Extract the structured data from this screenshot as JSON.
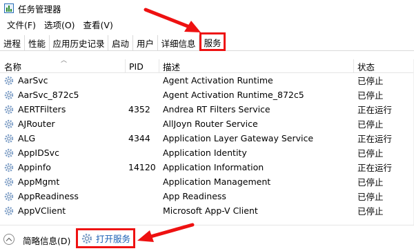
{
  "window": {
    "title": "任务管理器",
    "icon": "task-manager-icon"
  },
  "menu": [
    "文件(F)",
    "选项(O)",
    "查看(V)"
  ],
  "tabs": [
    "进程",
    "性能",
    "应用历史记录",
    "启动",
    "用户",
    "详细信息",
    "服务"
  ],
  "active_tab": "服务",
  "columns": {
    "name": "名称",
    "pid": "PID",
    "desc": "描述",
    "status": "状态"
  },
  "services": [
    {
      "name": "AarSvc",
      "pid": "",
      "desc": "Agent Activation Runtime",
      "status": "已停止"
    },
    {
      "name": "AarSvc_872c5",
      "pid": "",
      "desc": "Agent Activation Runtime_872c5",
      "status": "已停止"
    },
    {
      "name": "AERTFilters",
      "pid": "4352",
      "desc": "Andrea RT Filters Service",
      "status": "正在运行"
    },
    {
      "name": "AJRouter",
      "pid": "",
      "desc": "AllJoyn Router Service",
      "status": "已停止"
    },
    {
      "name": "ALG",
      "pid": "4344",
      "desc": "Application Layer Gateway Service",
      "status": "正在运行"
    },
    {
      "name": "AppIDSvc",
      "pid": "",
      "desc": "Application Identity",
      "status": "已停止"
    },
    {
      "name": "Appinfo",
      "pid": "14120",
      "desc": "Application Information",
      "status": "正在运行"
    },
    {
      "name": "AppMgmt",
      "pid": "",
      "desc": "Application Management",
      "status": "已停止"
    },
    {
      "name": "AppReadiness",
      "pid": "",
      "desc": "App Readiness",
      "status": "已停止"
    },
    {
      "name": "AppVClient",
      "pid": "",
      "desc": "Microsoft App-V Client",
      "status": "已停止"
    }
  ],
  "footer": {
    "brief_label": "简略信息(D)",
    "open_services_label": "打开服务"
  },
  "annotation_color": "#ee1111",
  "link_color": "#1a5fb4"
}
